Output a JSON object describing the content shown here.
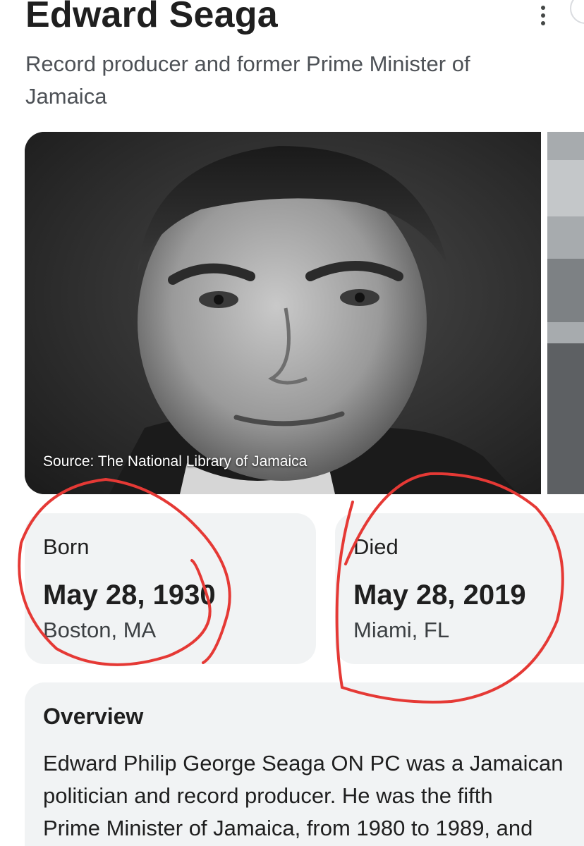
{
  "header": {
    "title": "Edward Seaga",
    "subtitle": "Record producer and former Prime Minister of Jamaica",
    "more_icon": "more-vert-icon"
  },
  "photo": {
    "source_label": "Source: The National Library of Jamaica"
  },
  "facts": {
    "born": {
      "label": "Born",
      "date": "May 28, 1930",
      "place": "Boston, MA"
    },
    "died": {
      "label": "Died",
      "date": "May 28, 2019",
      "place": "Miami, FL"
    }
  },
  "overview": {
    "title": "Overview",
    "lines": [
      "Edward Philip George Seaga ON PC was a Jamaican",
      "politician and record producer. He was the fifth",
      "Prime Minister of Jamaica, from 1980 to 1989, and"
    ]
  },
  "annotation_color": "#e53935"
}
